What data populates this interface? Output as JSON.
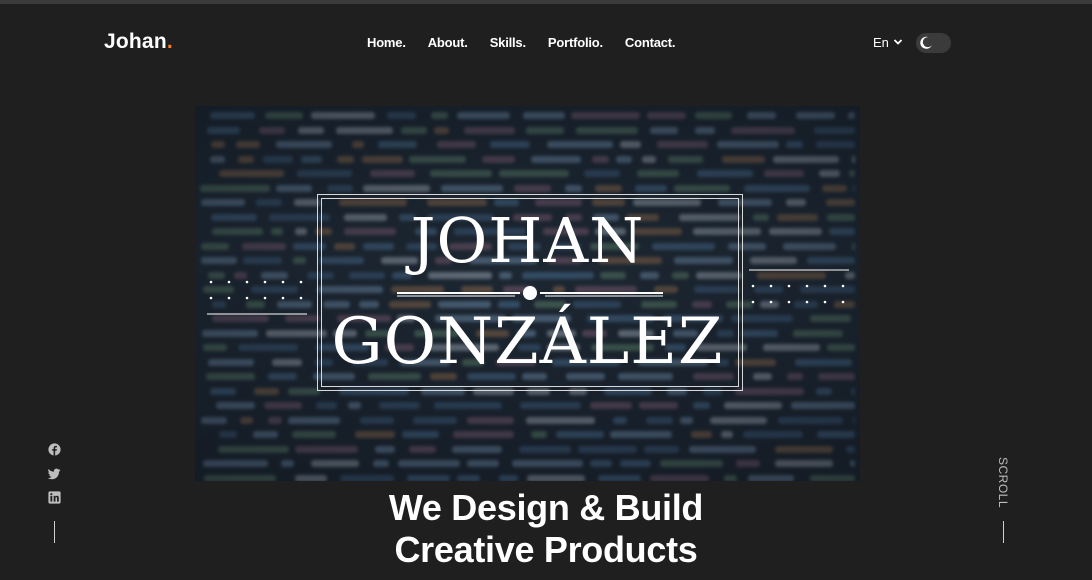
{
  "brand": {
    "name": "Johan",
    "dot": ".",
    "dot_color": "#ff7b2c"
  },
  "nav": {
    "items": [
      {
        "label": "Home."
      },
      {
        "label": "About."
      },
      {
        "label": "Skills."
      },
      {
        "label": "Portfolio."
      },
      {
        "label": "Contact."
      }
    ]
  },
  "header": {
    "language": "En",
    "language_icon": "chevron-down-icon",
    "theme_toggle_icon": "moon-icon"
  },
  "hero": {
    "first_name": "JOHAN",
    "last_name": "GONZÁLEZ",
    "background": "blurred-code-image"
  },
  "social": {
    "icons": [
      "facebook-icon",
      "twitter-icon",
      "linkedin-icon"
    ]
  },
  "scroll": {
    "label": "SCROLL"
  },
  "headline": {
    "line1": "We Design & Build",
    "line2": "Creative Products"
  },
  "colors": {
    "background": "#1f1f1f",
    "text": "#ffffff",
    "accent": "#ff7b2c"
  }
}
